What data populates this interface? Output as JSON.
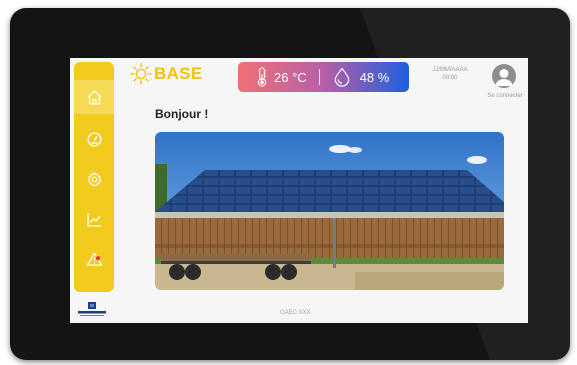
{
  "app": {
    "brand": "BASE"
  },
  "sidebar": {
    "items": [
      {
        "name": "home",
        "active": true
      },
      {
        "name": "gauge",
        "active": false
      },
      {
        "name": "settings",
        "active": false
      },
      {
        "name": "chart",
        "active": false
      },
      {
        "name": "alert",
        "active": false,
        "badge": true
      }
    ]
  },
  "weather": {
    "temperature": "26 °C",
    "humidity": "48 %"
  },
  "header": {
    "date": "JJ/MM/AAAA",
    "time": "00:00",
    "login_label": "Se connecter"
  },
  "main": {
    "greeting": "Bonjour !",
    "photo_subject": "solar-panel-barn-photo"
  },
  "footer": {
    "farm": "GAEC XXX",
    "company_logo_text": "SYSTEMES"
  },
  "colors": {
    "sidebar": "#f3cb1e",
    "brand": "#f2c300",
    "weather_start": "#f07175",
    "weather_end": "#1f5fe0"
  }
}
